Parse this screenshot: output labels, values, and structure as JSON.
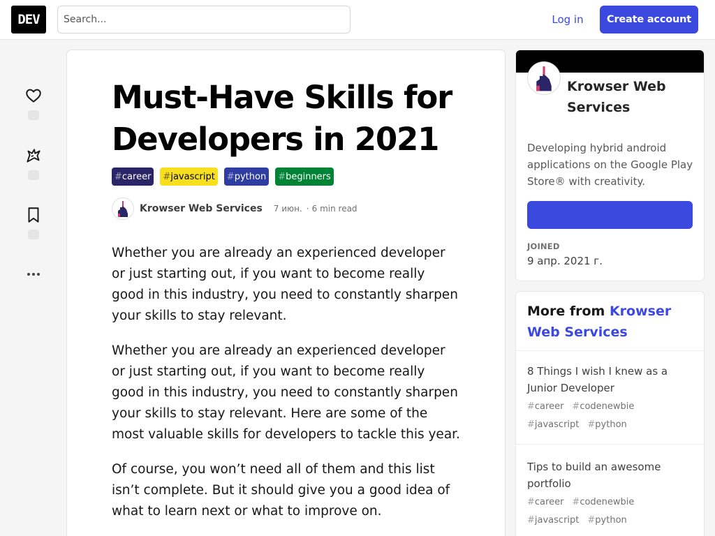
{
  "header": {
    "logo": "DEV",
    "search_placeholder": "Search...",
    "login_label": "Log in",
    "create_label": "Create account"
  },
  "reactions": [
    {
      "icon": "heart-icon"
    },
    {
      "icon": "unicorn-icon"
    },
    {
      "icon": "bookmark-icon"
    }
  ],
  "more_actions_icon": "ellipsis-icon",
  "article": {
    "title": "Must-Have Skills for Developers in 2021",
    "tags": [
      {
        "name": "career",
        "bg": "#2a2566",
        "fg": "#ffffff"
      },
      {
        "name": "javascript",
        "bg": "#f7df1e",
        "fg": "#000000"
      },
      {
        "name": "python",
        "bg": "#2f3da3",
        "fg": "#ffffff"
      },
      {
        "name": "beginners",
        "bg": "#008335",
        "fg": "#ffffff"
      }
    ],
    "author": "Krowser Web Services",
    "date": "7 июн.",
    "read_time": "6 min read",
    "paragraphs": [
      "Whether you are already an experienced developer or just starting out, if you want to become really good in this industry, you need to constantly sharpen your skills to stay relevant.",
      "Whether you are already an experienced developer or just starting out, if you want to become really good in this industry, you need to constantly sharpen your skills to stay relevant. Here are some of the most valuable skills for developers to tackle this year.",
      "Of course, you won’t need all of them and this list isn’t complete. But it should give you a good idea of what to learn next or what to improve on."
    ]
  },
  "profile": {
    "name": "Krowser Web Services",
    "description": "Developing hybrid android applications on the Google Play Store® with creativity.",
    "joined_label": "JOINED",
    "joined_value": "9 апр. 2021 г."
  },
  "more_from": {
    "prefix": "More from",
    "author": "Krowser Web Services",
    "items": [
      {
        "title": "8 Things I wish I knew as a Junior Developer",
        "tags": [
          "career",
          "codenewbie",
          "javascript",
          "python"
        ]
      },
      {
        "title": "Tips to build an awesome portfolio",
        "tags": [
          "career",
          "codenewbie",
          "javascript",
          "python"
        ]
      }
    ]
  },
  "colors": {
    "accent": "#3b49df",
    "logo_bg": "#000000"
  }
}
